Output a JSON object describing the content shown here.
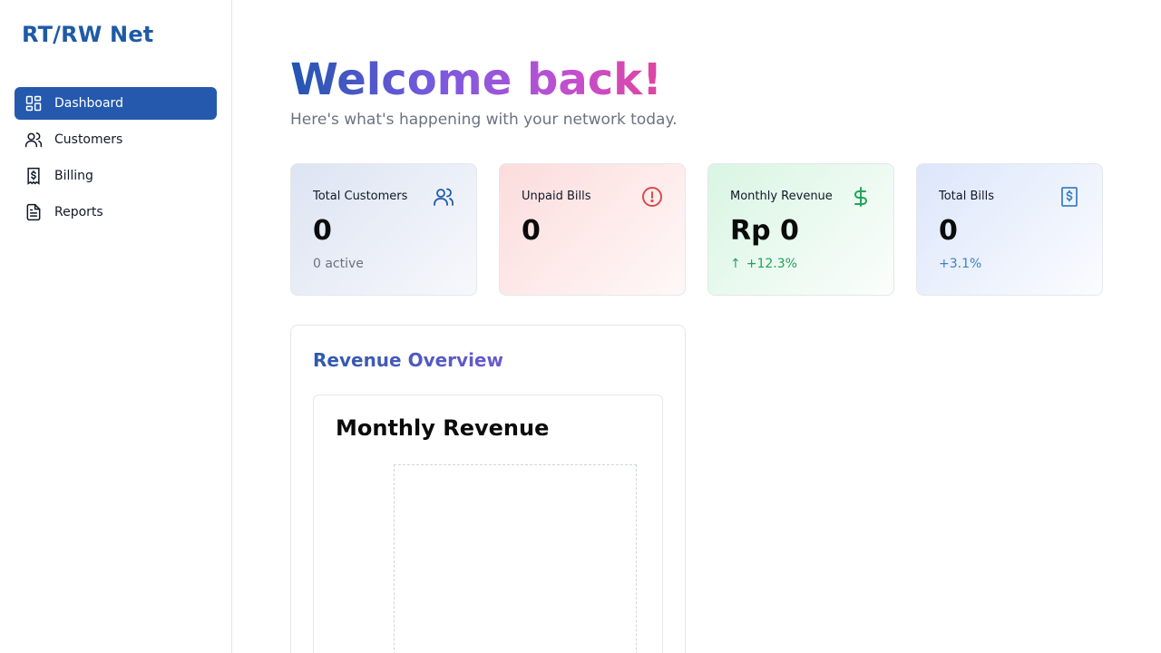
{
  "brand": "RT/RW Net",
  "sidebar": {
    "items": [
      {
        "label": "Dashboard",
        "icon": "dashboard-icon",
        "active": true
      },
      {
        "label": "Customers",
        "icon": "users-icon",
        "active": false
      },
      {
        "label": "Billing",
        "icon": "billing-icon",
        "active": false
      },
      {
        "label": "Reports",
        "icon": "document-icon",
        "active": false
      }
    ]
  },
  "header": {
    "title": "Welcome back!",
    "subtitle": "Here's what's happening with your network today."
  },
  "cards": [
    {
      "title": "Total Customers",
      "value": "0",
      "sub": "0 active",
      "icon": "users-icon",
      "color": "#1f5aa6"
    },
    {
      "title": "Unpaid Bills",
      "value": "0",
      "sub": "",
      "icon": "alert-circle-icon",
      "color": "#dc4a4a"
    },
    {
      "title": "Monthly Revenue",
      "value": "Rp 0",
      "sub": "+12.3%",
      "icon": "dollar-icon",
      "color": "#22a35a"
    },
    {
      "title": "Total Bills",
      "value": "0",
      "sub": "+3.1%",
      "icon": "receipt-icon",
      "color": "#3b82c4"
    }
  ],
  "revenue_panel": {
    "title": "Revenue Overview",
    "chart_title": "Monthly Revenue"
  },
  "colors": {
    "primary": "#2459ad",
    "danger": "#dc4a4a",
    "success": "#22a35a"
  }
}
